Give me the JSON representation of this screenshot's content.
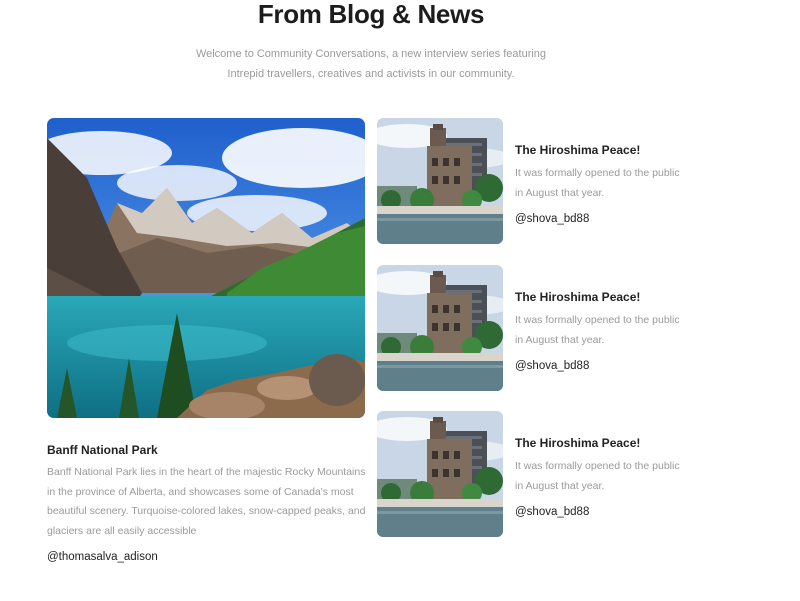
{
  "header": {
    "title": "From Blog & News",
    "subtitle_line1": "Welcome to Community Conversations, a new interview series featuring",
    "subtitle_line2": "Intrepid travellers, creatives and activists in our community."
  },
  "featured": {
    "image_subject": "mountain-lake-photo",
    "title": "Banff National Park",
    "text": "Banff National Park lies in the heart of the majestic Rocky Mountains in the province of Alberta, and showcases some of Canada's most beautiful scenery. Turquoise-colored lakes, snow-capped peaks, and glaciers are all easily accessible",
    "author": "@thomasalva_adison"
  },
  "posts": [
    {
      "image_subject": "hiroshima-dome-photo",
      "title": "The Hiroshima Peace!",
      "text": "It was formally opened to the public in August that year.",
      "author": "@shova_bd88"
    },
    {
      "image_subject": "hiroshima-dome-photo",
      "title": "The Hiroshima Peace!",
      "text": "It was formally opened to the public in August that year.",
      "author": "@shova_bd88"
    },
    {
      "image_subject": "hiroshima-dome-photo",
      "title": "The Hiroshima Peace!",
      "text": "It was formally opened to the public in August that year.",
      "author": "@shova_bd88"
    }
  ]
}
